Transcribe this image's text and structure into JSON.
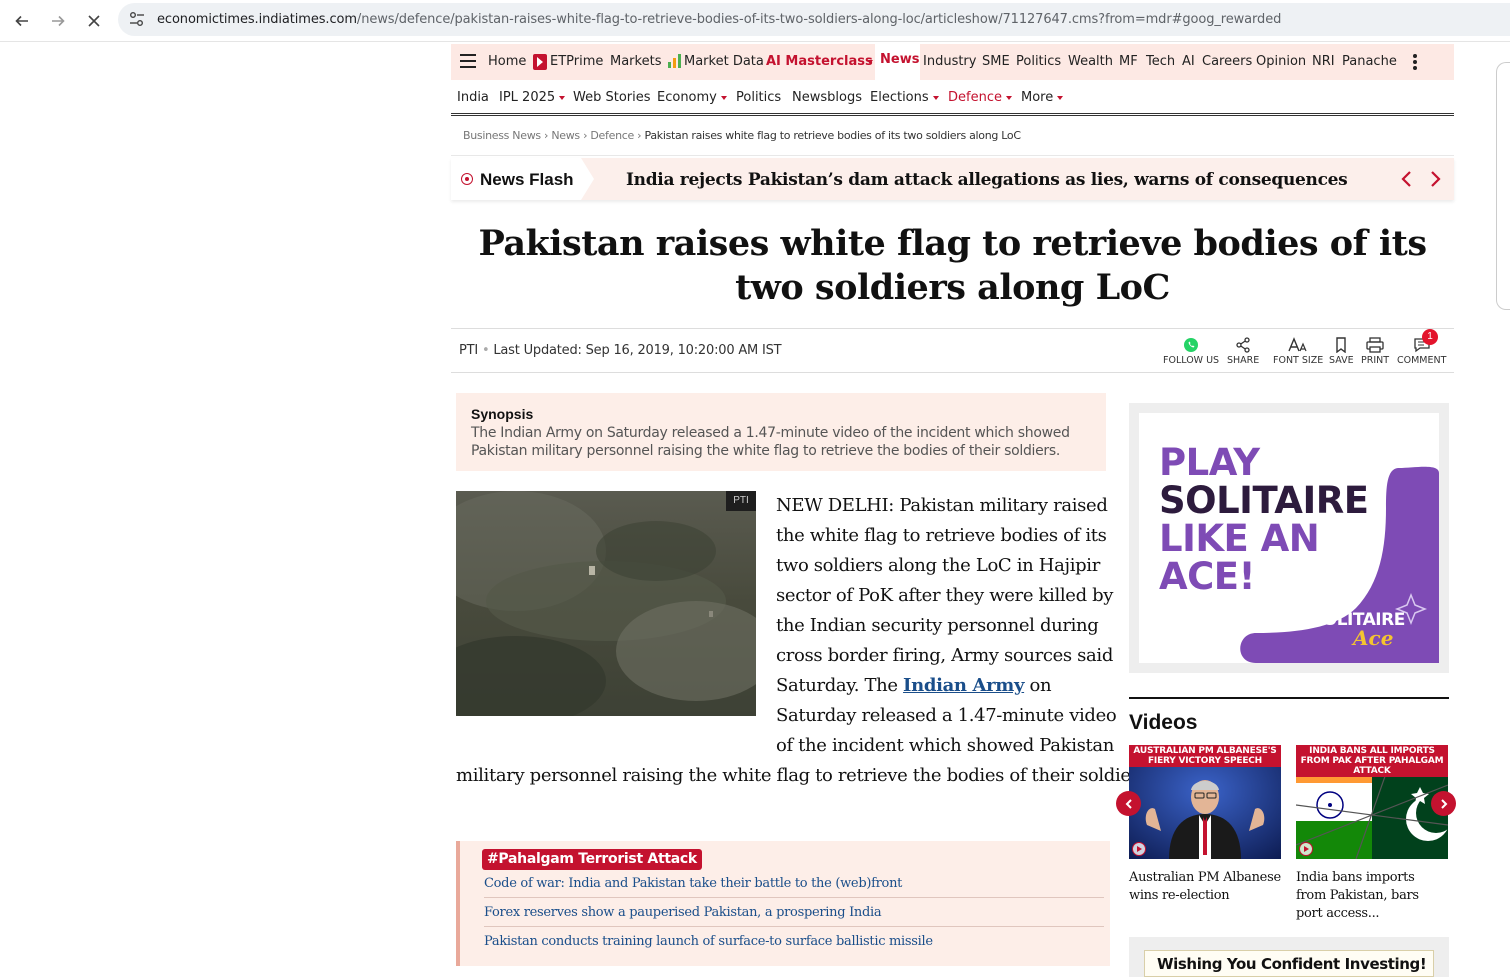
{
  "browser": {
    "url_host": "economictimes.indiatimes.com",
    "url_path": "/news/defence/pakistan-raises-white-flag-to-retrieve-bodies-of-its-two-soldiers-along-loc/articleshow/71127647.cms?from=mdr#goog_rewarded"
  },
  "topnav": {
    "items": [
      "Home",
      "ETPrime",
      "Markets",
      "Market Data",
      "AI Masterclass",
      "News",
      "Industry",
      "SME",
      "Politics",
      "Wealth",
      "MF",
      "Tech",
      "AI",
      "Careers",
      "Opinion",
      "NRI",
      "Panache"
    ]
  },
  "subnav": {
    "items": [
      "India",
      "IPL 2025",
      "Web Stories",
      "Economy",
      "Politics",
      "Newsblogs",
      "Elections",
      "Defence",
      "More"
    ]
  },
  "breadcrumb": {
    "items": [
      "Business News",
      "News",
      "Defence",
      "Pakistan raises white flag to retrieve bodies of its two soldiers along LoC"
    ],
    "separator": "›"
  },
  "newsflash": {
    "label": "News Flash",
    "headline": "India rejects Pakistan’s dam attack allegations as lies, warns of consequences"
  },
  "article": {
    "title_line1": "Pakistan raises white flag to retrieve bodies of its",
    "title_line2": "two soldiers along LoC",
    "source": "PTI",
    "updated": "Last Updated: Sep 16, 2019, 10:20:00 AM IST",
    "synopsis_title": "Synopsis",
    "synopsis_text": "The Indian Army on Saturday released a 1.47-minute video of the incident which showed Pakistan military personnel raising the white flag to retrieve the bodies of their soldiers.",
    "image_credit": "PTI",
    "body_lines": [
      "NEW DELHI: Pakistan military raised",
      "the white flag to retrieve bodies of its",
      "two soldiers along the LoC in Hajipir",
      "sector of PoK after they were killed by",
      "the Indian security personnel during",
      "cross border firing, Army sources said",
      "Saturday. The ",
      " on",
      "Saturday released a 1.47-minute video",
      "of the incident which showed Pakistan",
      "military personnel raising the white flag to retrieve the bodies of their soldiers."
    ],
    "body_link": "Indian Army"
  },
  "tools": {
    "follow": "FOLLOW US",
    "share": "SHARE",
    "font": "FONT SIZE",
    "save": "SAVE",
    "print": "PRINT",
    "comment": "COMMENT",
    "comment_count": "1"
  },
  "related": {
    "tag": "#Pahalgam Terrorist Attack",
    "links": [
      "Code of war: India and Pakistan take their battle to the (web)front",
      "Forex reserves show a pauperised Pakistan, a prospering India",
      "Pakistan conducts training launch of surface-to surface ballistic missile"
    ]
  },
  "sidebar": {
    "ad": {
      "lines": [
        "PLAY",
        "SOLITAIRE",
        "LIKE AN",
        "ACE!"
      ],
      "brand1": "SOLITAIRE",
      "brand2": "Ace",
      "colors": {
        "purple": "#7e4bb5",
        "dark": "#2d1b3d",
        "accent": "#f4c430"
      }
    },
    "videos_title": "Videos",
    "videos": [
      {
        "caption": "AUSTRALIAN PM ALBANESE'S FIERY VICTORY SPEECH",
        "title": "Australian PM Albanese wins re-election"
      },
      {
        "caption": "INDIA BANS ALL IMPORTS FROM PAK AFTER PAHALGAM ATTACK",
        "title": "India bans imports from Pakistan, bars port access..."
      }
    ],
    "ad2_text": "Wishing You Confident Investing!"
  },
  "colors": {
    "brand_red": "#c4122f",
    "nav_bg": "#fde9e4",
    "link_blue": "#1a4e8a"
  }
}
